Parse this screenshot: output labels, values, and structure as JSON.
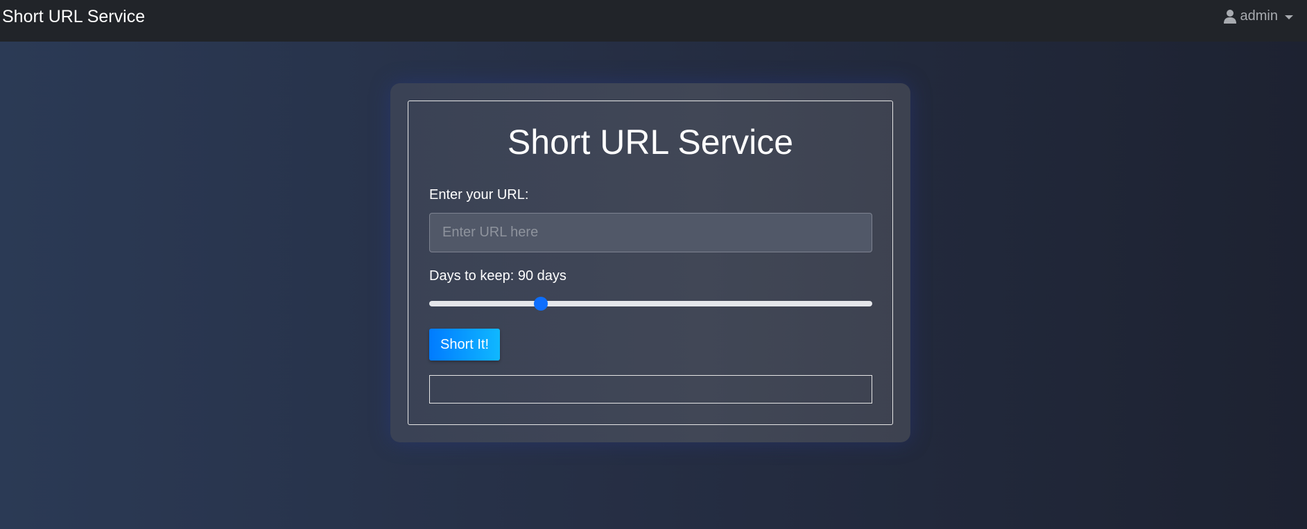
{
  "navbar": {
    "brand": "Short URL Service",
    "user": {
      "icon": "user-icon",
      "name": "admin"
    }
  },
  "card": {
    "title": "Short URL Service",
    "url_label": "Enter your URL:",
    "url_input": {
      "value": "",
      "placeholder": "Enter URL here"
    },
    "days_label": "Days to keep: 90 days",
    "days_slider": {
      "value": 90,
      "fraction": 0.252
    },
    "submit_label": "Short It!",
    "result_text": ""
  },
  "colors": {
    "navbar_bg": "#212429",
    "accent": "#0d6efd",
    "button_gradient_start": "#007bff",
    "button_gradient_end": "#10b8ff"
  }
}
